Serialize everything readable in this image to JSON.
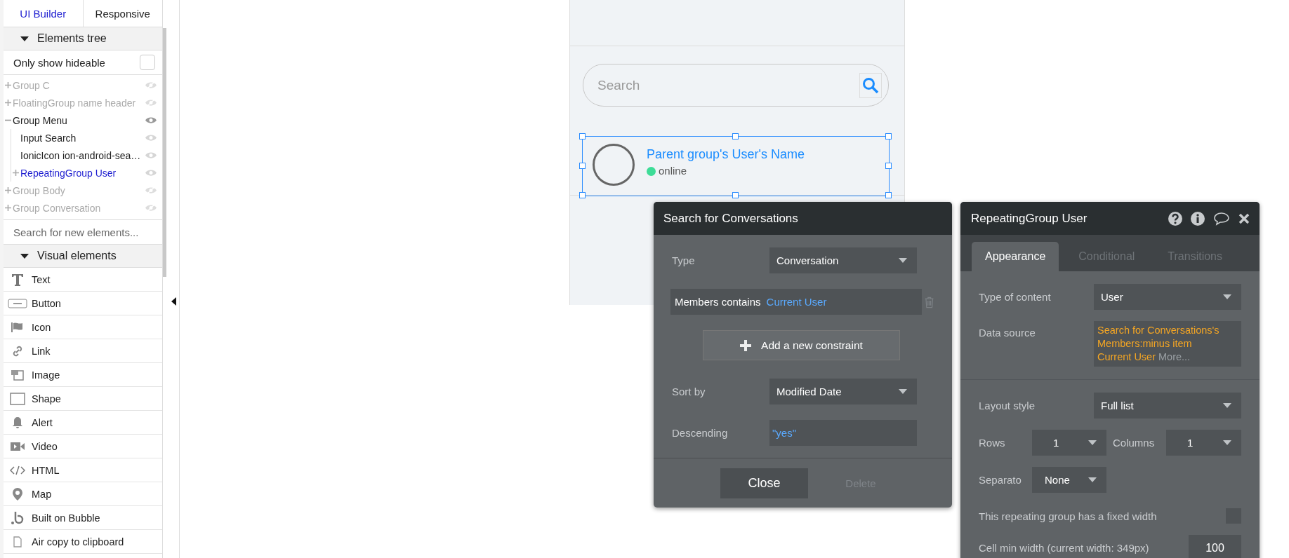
{
  "sidebar": {
    "tabs": [
      {
        "label": "UI Builder",
        "selected": true
      },
      {
        "label": "Responsive",
        "selected": false
      }
    ],
    "tree_header": {
      "label": "Elements tree",
      "expanded": true
    },
    "only_hideable": {
      "label": "Only show hideable",
      "checked": false
    },
    "tree": [
      {
        "label": "Group C",
        "kind": "group",
        "expanded": false,
        "visible": false,
        "selected": false
      },
      {
        "label": "FloatingGroup name header",
        "kind": "group",
        "expanded": false,
        "visible": false,
        "selected": false
      },
      {
        "label": "Group Menu",
        "kind": "group",
        "expanded": true,
        "visible": true,
        "selected": false,
        "children": [
          {
            "label": "Input Search",
            "kind": "leaf",
            "visible": true,
            "selected": false
          },
          {
            "label": "IonicIcon ion-android-sea…",
            "kind": "leaf",
            "visible": true,
            "selected": false
          },
          {
            "label": "RepeatingGroup User",
            "kind": "group",
            "expanded": false,
            "visible": true,
            "selected": true
          }
        ]
      },
      {
        "label": "Group Body",
        "kind": "group",
        "expanded": false,
        "visible": false,
        "selected": false
      },
      {
        "label": "Group Conversation",
        "kind": "group",
        "expanded": false,
        "visible": false,
        "selected": false
      }
    ],
    "search": {
      "placeholder": "Search for new elements..."
    },
    "visual_header": {
      "label": "Visual elements",
      "expanded": true
    },
    "visual_elements": [
      "Text",
      "Button",
      "Icon",
      "Link",
      "Image",
      "Shape",
      "Alert",
      "Video",
      "HTML",
      "Map",
      "Built on Bubble",
      "Air copy to clipboard"
    ]
  },
  "canvas": {
    "search_field": {
      "placeholder": "Search"
    },
    "row": {
      "name": "Parent group's User's Name",
      "status": "online",
      "selected": true
    }
  },
  "search_dialog": {
    "title": "Search for Conversations",
    "type": {
      "label": "Type",
      "value": "Conversation"
    },
    "constraint": {
      "field": "Members contains",
      "value": "Current User"
    },
    "add_button": "Add a new constraint",
    "sort_by": {
      "label": "Sort by",
      "value": "Modified Date"
    },
    "descending": {
      "label": "Descending",
      "value": "\"yes\""
    },
    "buttons": [
      {
        "label": "Close",
        "disabled": false
      },
      {
        "label": "Delete",
        "disabled": true
      }
    ]
  },
  "property_dialog": {
    "title": "RepeatingGroup User",
    "tabs": [
      {
        "label": "Appearance",
        "selected": true
      },
      {
        "label": "Conditional",
        "selected": false
      },
      {
        "label": "Transitions",
        "selected": false
      }
    ],
    "type_of_content": {
      "label": "Type of content",
      "value": "User"
    },
    "data_source": {
      "label": "Data source",
      "value": "Search for Conversations's Members:minus item Current User",
      "more": "More..."
    },
    "layout_style": {
      "label": "Layout style",
      "value": "Full list"
    },
    "rows": {
      "label": "Rows",
      "value": "1"
    },
    "columns": {
      "label": "Columns",
      "value": "1"
    },
    "separator": {
      "label": "Separato",
      "value": "None"
    },
    "fixed_width": {
      "label": "This repeating group has a fixed width",
      "checked": false
    },
    "cell_min_width": {
      "label": "Cell min width (current width: 349px)",
      "value": "100"
    }
  }
}
